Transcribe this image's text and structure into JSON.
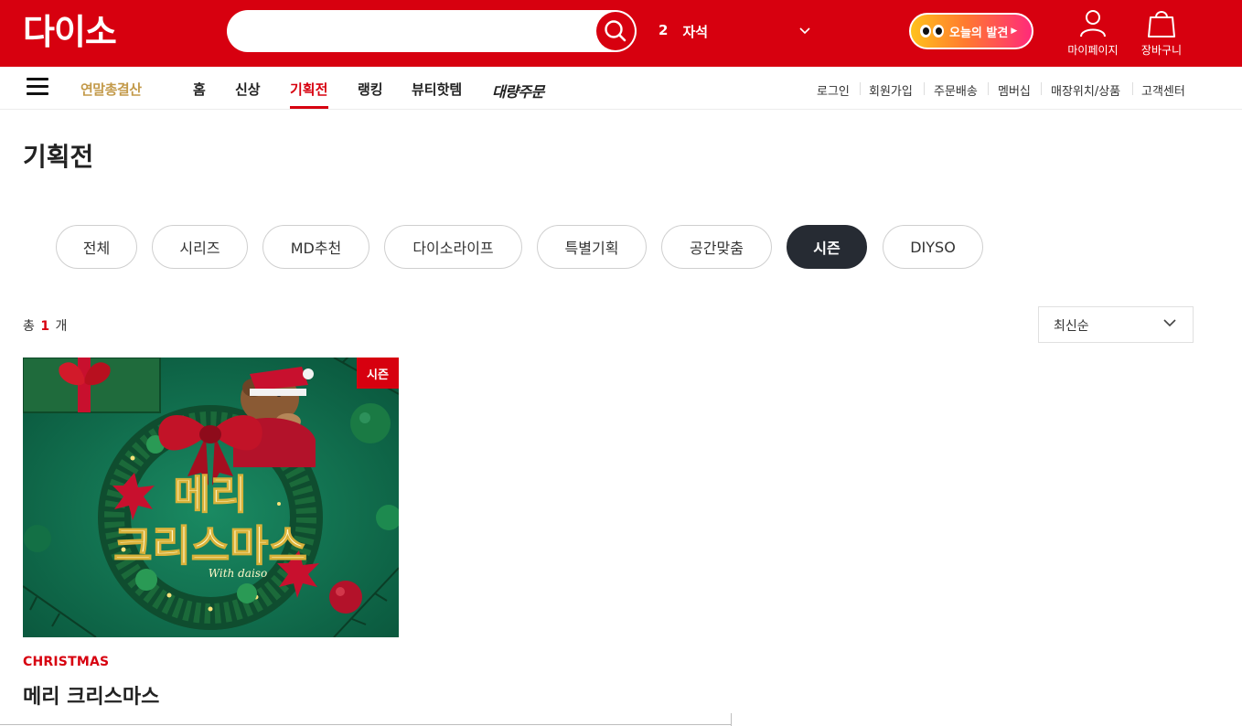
{
  "header": {
    "logo_text": "다이소",
    "search_placeholder": "",
    "trending": {
      "rank": "2",
      "keyword": "자석"
    },
    "discover_label": "오늘의 발견",
    "mypage_label": "마이페이지",
    "cart_label": "장바구니",
    "brand_color": "#d7000f"
  },
  "nav": {
    "special": "연말총결산",
    "items": [
      "홈",
      "신상",
      "기획전",
      "랭킹",
      "뷰티핫템",
      "대량주문"
    ],
    "active": "기획전",
    "utility": [
      "로그인",
      "회원가입",
      "주문배송",
      "멤버십",
      "매장위치/상품",
      "고객센터"
    ]
  },
  "page": {
    "title": "기획전",
    "chips": [
      "전체",
      "시리즈",
      "MD추천",
      "다이소라이프",
      "특별기획",
      "공간맞춤",
      "시즌",
      "DIYSO"
    ],
    "active_chip": "시즌",
    "total_prefix": "총",
    "total_count": "1",
    "total_suffix": "개",
    "sort_selected": "최신순"
  },
  "cards": [
    {
      "badge": "시즌",
      "image_text_line1": "메리",
      "image_text_line2": "크리스마스",
      "image_text_sub": "With daiso",
      "category": "CHRISTMAS",
      "title": "메리 크리스마스"
    }
  ]
}
